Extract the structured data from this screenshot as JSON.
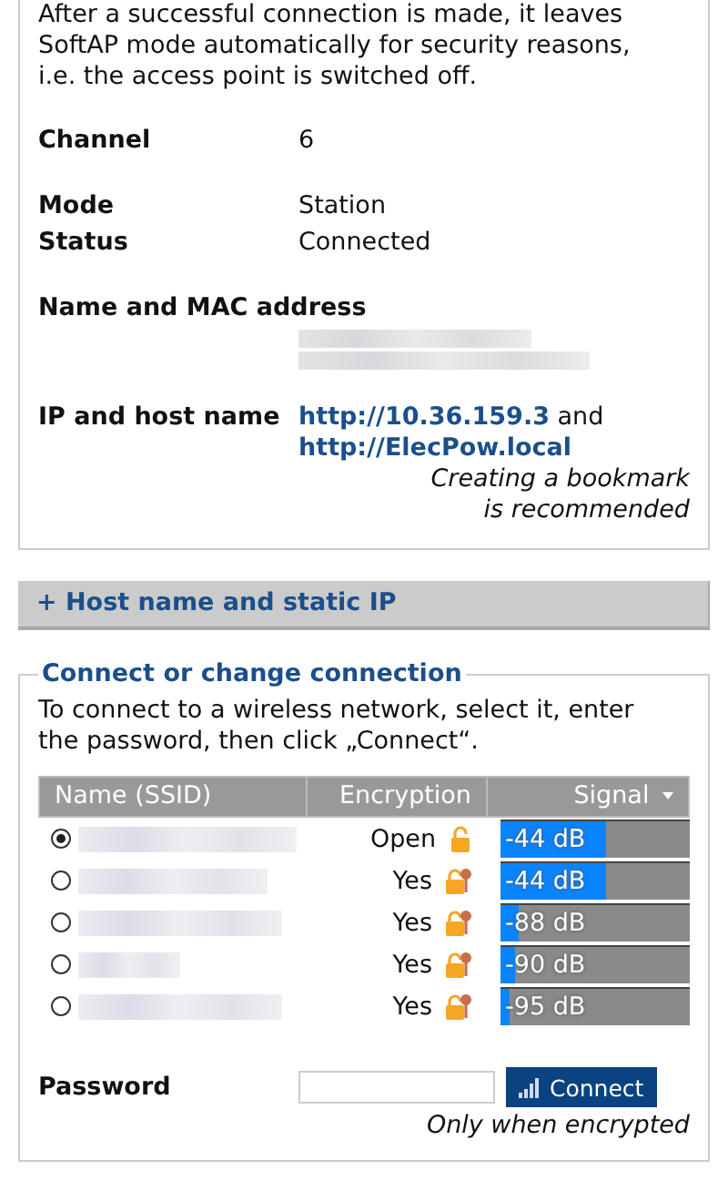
{
  "intro": "After a successful connection is made, it leaves SoftAP mode automatically for security reasons, i.e. the access point is switched off.",
  "detail_groups": [
    [
      {
        "label": "Channel",
        "value": "6"
      }
    ],
    [
      {
        "label": "Mode",
        "value": "Station"
      },
      {
        "label": "Status",
        "value": "Connected"
      }
    ]
  ],
  "mac_label": "Name and MAC address",
  "ip": {
    "label": "IP and host name",
    "link_1": "http://10.36.159.3",
    "joiner": "and",
    "link_2": "http://ElecPow.local",
    "note_1": "Creating a bookmark",
    "note_2": "is recommended"
  },
  "host_section": {
    "title": "+ Host name and static IP",
    "expanded": false
  },
  "connect": {
    "legend": "Connect or change connection",
    "instructions": "To connect to a wireless network, select it, enter the password, then click „Connect“.",
    "columns": [
      "Name (SSID)",
      "Encryption",
      "Signal"
    ],
    "networks": [
      {
        "selected": true,
        "encryption": "Open",
        "locked": false,
        "level": 0.56,
        "reading": "-44 dB"
      },
      {
        "selected": false,
        "encryption": "Yes",
        "locked": true,
        "level": 0.56,
        "reading": "-44 dB"
      },
      {
        "selected": false,
        "encryption": "Yes",
        "locked": true,
        "level": 0.1,
        "reading": "-88 dB"
      },
      {
        "selected": false,
        "encryption": "Yes",
        "locked": true,
        "level": 0.08,
        "reading": "-90 dB"
      },
      {
        "selected": false,
        "encryption": "Yes",
        "locked": true,
        "level": 0.05,
        "reading": "-95 dB"
      }
    ],
    "password_label": "Password",
    "button": "Connect",
    "hint": "Only when encrypted"
  }
}
